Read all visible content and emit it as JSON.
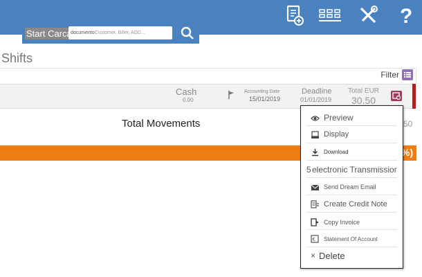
{
  "header": {
    "start_label": "Start Carca",
    "search_doc": "documento",
    "search_hint": "Customer, Biller, ADD...",
    "icons": [
      "document-add-icon",
      "grid-icon",
      "tools-icon",
      "help-icon"
    ],
    "bar_color": "#4a82c0"
  },
  "page": {
    "title": "Shifts"
  },
  "filter": {
    "label": "Filter"
  },
  "shift": {
    "cash_label": "Cash",
    "cash_value": "0.00",
    "accounting_label": "Accounting Date",
    "accounting_value": "15/01/2019",
    "deadline_label": "Deadline",
    "deadline_value": "01/01/2019",
    "total_label": "Total EUR",
    "total_value": "30.50"
  },
  "summary": {
    "total_movements": "Total Movements",
    "peek_value": "50",
    "peek_percent": "%)"
  },
  "menu": {
    "items": [
      {
        "label": "Preview",
        "icon": "eye-icon"
      },
      {
        "label": "Display",
        "icon": "display-icon"
      },
      {
        "label": "Download",
        "icon": "download-icon"
      },
      {
        "label": "electronic Transmission",
        "icon": "",
        "prefix": "5"
      },
      {
        "label": "Send Dream Email",
        "icon": "mail-icon"
      },
      {
        "label": "Create Credit Note",
        "icon": "credit-note-icon"
      },
      {
        "label": "Copy Invoice",
        "icon": "copy-icon"
      },
      {
        "label": "Statement Of Account",
        "icon": "statement-icon"
      },
      {
        "label": "Delete",
        "icon": "",
        "prefix": "×"
      }
    ]
  },
  "colors": {
    "accent": "#4a82c0",
    "orange": "#f07d14",
    "red": "#b02020",
    "purple": "#8e6fb8",
    "menu_button": "#a03a5a"
  }
}
